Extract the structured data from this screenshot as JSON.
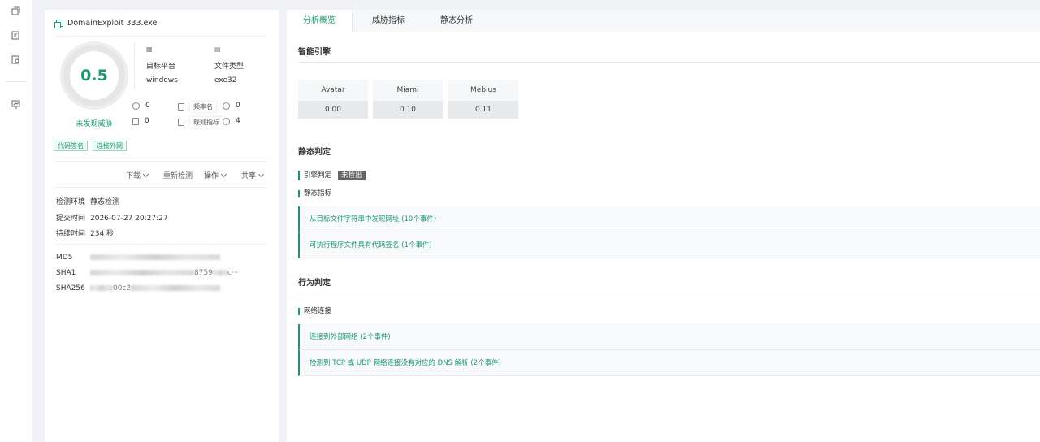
{
  "rail": {
    "icons": [
      "stack-icon",
      "doc-check-icon",
      "doc-search-icon",
      "chart-icon"
    ]
  },
  "file": {
    "name": "DomainExploit 333.exe",
    "score": "0.5",
    "verdict": "未发现威胁",
    "platform_label": "目标平台",
    "platform_value": "windows",
    "type_label": "文件类型",
    "type_value": "exe32",
    "stats": [
      {
        "value": "0"
      },
      {
        "label": "频率名",
        "value": "0"
      },
      {
        "value": "0"
      },
      {
        "label": "规则指标",
        "value": "4"
      }
    ],
    "tags": [
      "代码签名",
      "连接外网"
    ],
    "actions": [
      "下载",
      "重新检测",
      "操作",
      "共享"
    ],
    "env_label": "检测环境",
    "env_value": "静态检测",
    "submit_label": "提交时间",
    "submit_value": "2026-07-27 20:27:27",
    "duration_label": "持续时间",
    "duration_value": "234 秒",
    "md5_label": "MD5",
    "sha1_label": "SHA1",
    "sha1_visible": "8759",
    "sha1_suffix": "c···",
    "sha256_label": "SHA256",
    "sha256_visible": "00c2"
  },
  "tabs": [
    "分析概览",
    "威胁指标",
    "静态分析"
  ],
  "engines_title": "智能引擎",
  "engines": [
    {
      "name": "Avatar",
      "value": "0.00"
    },
    {
      "name": "Miami",
      "value": "0.10"
    },
    {
      "name": "Mebius",
      "value": "0.11"
    }
  ],
  "static": {
    "title": "静态判定",
    "engine_label": "引擎判定",
    "engine_badge": "未检出",
    "indicators_label": "静态指标",
    "indicators": [
      "从目标文件字符串中发现网址 (10个事件)",
      "可执行程序文件具有代码签名 (1个事件)"
    ]
  },
  "behavior": {
    "title": "行为判定",
    "net_label": "网络连接",
    "items": [
      "连接到外部网络 (2个事件)",
      "检测到 TCP 或 UDP 网络连接没有对应的 DNS 解析 (2个事件)"
    ]
  },
  "colors": {
    "accent": "#1a9b6f"
  }
}
